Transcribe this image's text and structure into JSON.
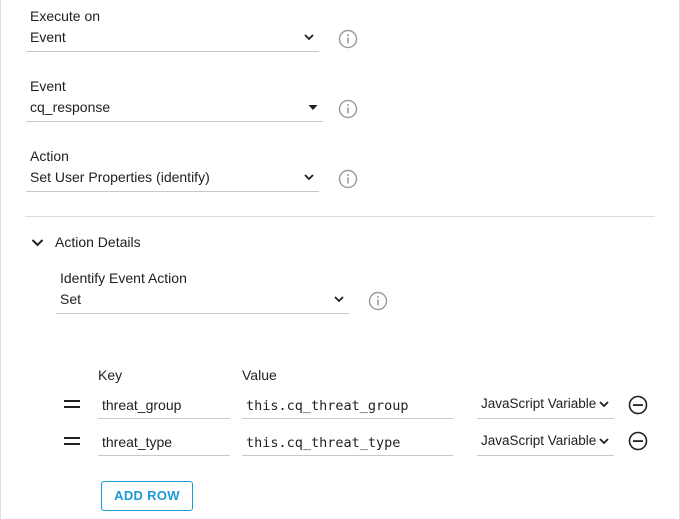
{
  "execute_on": {
    "label": "Execute on",
    "value": "Event"
  },
  "event": {
    "label": "Event",
    "value": "cq_response"
  },
  "action": {
    "label": "Action",
    "value": "Set User Properties (identify)"
  },
  "action_details": {
    "toggle_label": "Action Details",
    "identify_event_action": {
      "label": "Identify Event Action",
      "value": "Set"
    },
    "table": {
      "key_header": "Key",
      "value_header": "Value",
      "rows": [
        {
          "key": "threat_group",
          "value": "this.cq_threat_group",
          "type": "JavaScript Variable"
        },
        {
          "key": "threat_type",
          "value": "this.cq_threat_type",
          "type": "JavaScript Variable"
        }
      ]
    },
    "add_row_label": "ADD ROW"
  },
  "icons": {
    "dropdown": "chevron-down-icon",
    "info": "info-icon",
    "collapse": "chevron-down-icon",
    "drag": "drag-handle-icon",
    "remove": "remove-circle-icon"
  },
  "colors": {
    "accent": "#1a9ad6",
    "icon_gray": "#9e9e9e"
  }
}
